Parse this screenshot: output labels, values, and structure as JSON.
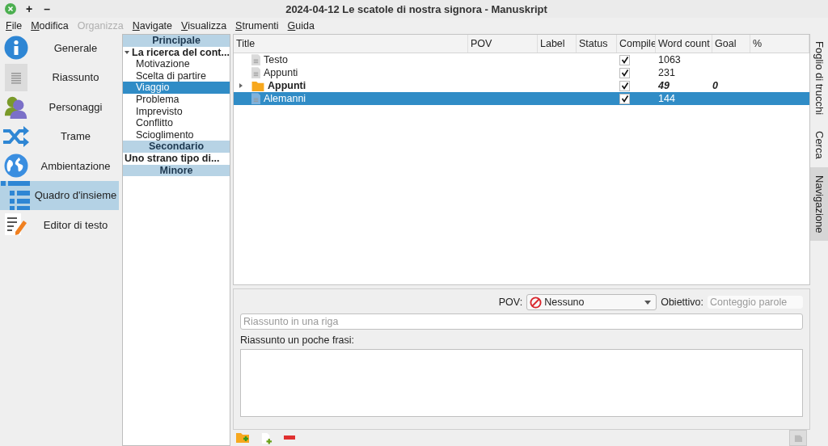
{
  "window": {
    "title": "2024-04-12 Le scatole di nostra signora - Manuskript",
    "controls": [
      "+",
      "–"
    ]
  },
  "menu": [
    {
      "label": "File",
      "disabled": false
    },
    {
      "label": "Modifica",
      "disabled": false
    },
    {
      "label": "Organizza",
      "disabled": true
    },
    {
      "label": "Navigate",
      "disabled": false
    },
    {
      "label": "Visualizza",
      "disabled": false
    },
    {
      "label": "Strumenti",
      "disabled": false
    },
    {
      "label": "Guida",
      "disabled": false
    }
  ],
  "sidebar": {
    "items": [
      {
        "label": "Generale",
        "selected": false
      },
      {
        "label": "Riassunto",
        "selected": false
      },
      {
        "label": "Personaggi",
        "selected": false
      },
      {
        "label": "Trame",
        "selected": false
      },
      {
        "label": "Ambientazione",
        "selected": false
      },
      {
        "label": "Quadro d'insieme",
        "selected": true
      },
      {
        "label": "Editor di testo",
        "selected": false
      }
    ]
  },
  "plot_list": {
    "groups": [
      {
        "heading": "Principale",
        "items": [
          {
            "label": "La ricerca del cont...",
            "selected": false,
            "expanded": true,
            "children": [
              {
                "label": "Motivazione",
                "selected": false
              },
              {
                "label": "Scelta di partire",
                "selected": false
              },
              {
                "label": "Viaggio",
                "selected": true
              },
              {
                "label": "Problema",
                "selected": false
              },
              {
                "label": "Imprevisto",
                "selected": false
              },
              {
                "label": "Conflitto",
                "selected": false
              },
              {
                "label": "Scioglimento",
                "selected": false
              }
            ]
          }
        ]
      },
      {
        "heading": "Secondario",
        "items": [
          {
            "label": "Uno strano tipo di...",
            "selected": false
          }
        ]
      },
      {
        "heading": "Minore"
      }
    ]
  },
  "outline": {
    "columns": [
      "Title",
      "POV",
      "Label",
      "Status",
      "Compile",
      "Word count",
      "Goal",
      "%"
    ],
    "rows": [
      {
        "kind": "document",
        "title": "Testo",
        "compile": true,
        "word_count": "1063",
        "selected": false
      },
      {
        "kind": "document",
        "title": "Appunti",
        "compile": true,
        "word_count": "231",
        "selected": false
      },
      {
        "kind": "folder",
        "title": "Appunti",
        "expanded": false,
        "compile": true,
        "word_count": "49",
        "goal": "0",
        "selected": false
      },
      {
        "kind": "document",
        "title": "Alemanni",
        "compile": true,
        "word_count": "144",
        "selected": true
      }
    ]
  },
  "editor": {
    "pov_label": "POV:",
    "pov_value": "Nessuno",
    "goal_label": "Obiettivo:",
    "goal_placeholder": "Conteggio parole",
    "one_line_placeholder": "Riassunto in una riga",
    "summary_label": "Riassunto un poche frasi:"
  },
  "side_tabs": [
    {
      "label": "Foglio di trucchi",
      "selected": false
    },
    {
      "label": "Cerca",
      "selected": false
    },
    {
      "label": "Navigazione",
      "selected": true
    }
  ]
}
